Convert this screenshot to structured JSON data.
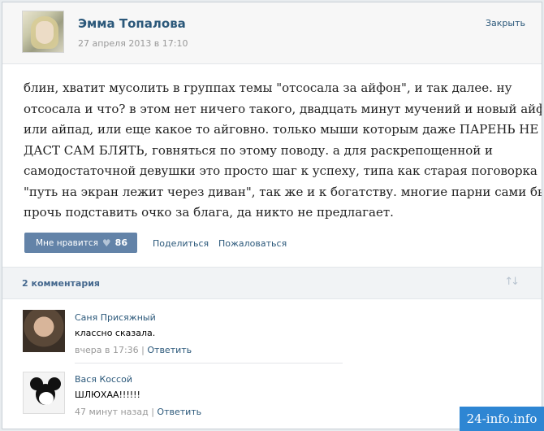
{
  "post": {
    "author_name": "Эмма Топалова",
    "date": "27 апреля 2013 в 17:10",
    "close_label": "Закрыть",
    "text_lines": [
      "блин, хватит мусолить в группах темы \"отсосала за айфон\", и так далее. ну",
      "отсосала и что? в этом нет ничего такого, двадцать минут мучений и новый айфон",
      "или айпад, или еще какое то айговно. только мыши которым даже ПАРЕНЬ НЕ",
      "ДАСТ САМ БЛЯТЬ, говняться по этому поводу. а для раскрепощенной и",
      "самодостаточной девушки это просто шаг к успеху, типа как старая поговорка",
      "\"путь на экран лежит через диван\", так же и к богатству. многие парни сами бы не",
      "прочь подставить очко за блага, да никто не предлагает."
    ]
  },
  "actions": {
    "like_label": "Мне нравится",
    "like_icon": "heart-icon",
    "like_count": "86",
    "share_label": "Поделиться",
    "report_label": "Пожаловаться"
  },
  "comments_header": {
    "count_label": "2 комментария",
    "sort_icon": "sort-arrows-icon"
  },
  "comments": [
    {
      "name": "Саня Присяжный",
      "text": "классно сказала.",
      "time": "вчера в 17:36",
      "separator": "|",
      "reply_label": "Ответить"
    },
    {
      "name": "Вася Коссой",
      "text": "ШЛЮХАА!!!!!!",
      "time": "47 минут назад",
      "separator": "|",
      "reply_label": "Ответить"
    }
  ],
  "watermark": "24-info.info",
  "colors": {
    "link": "#2b587a",
    "like_button": "#6383a8",
    "watermark_bg": "#2e86d3"
  }
}
